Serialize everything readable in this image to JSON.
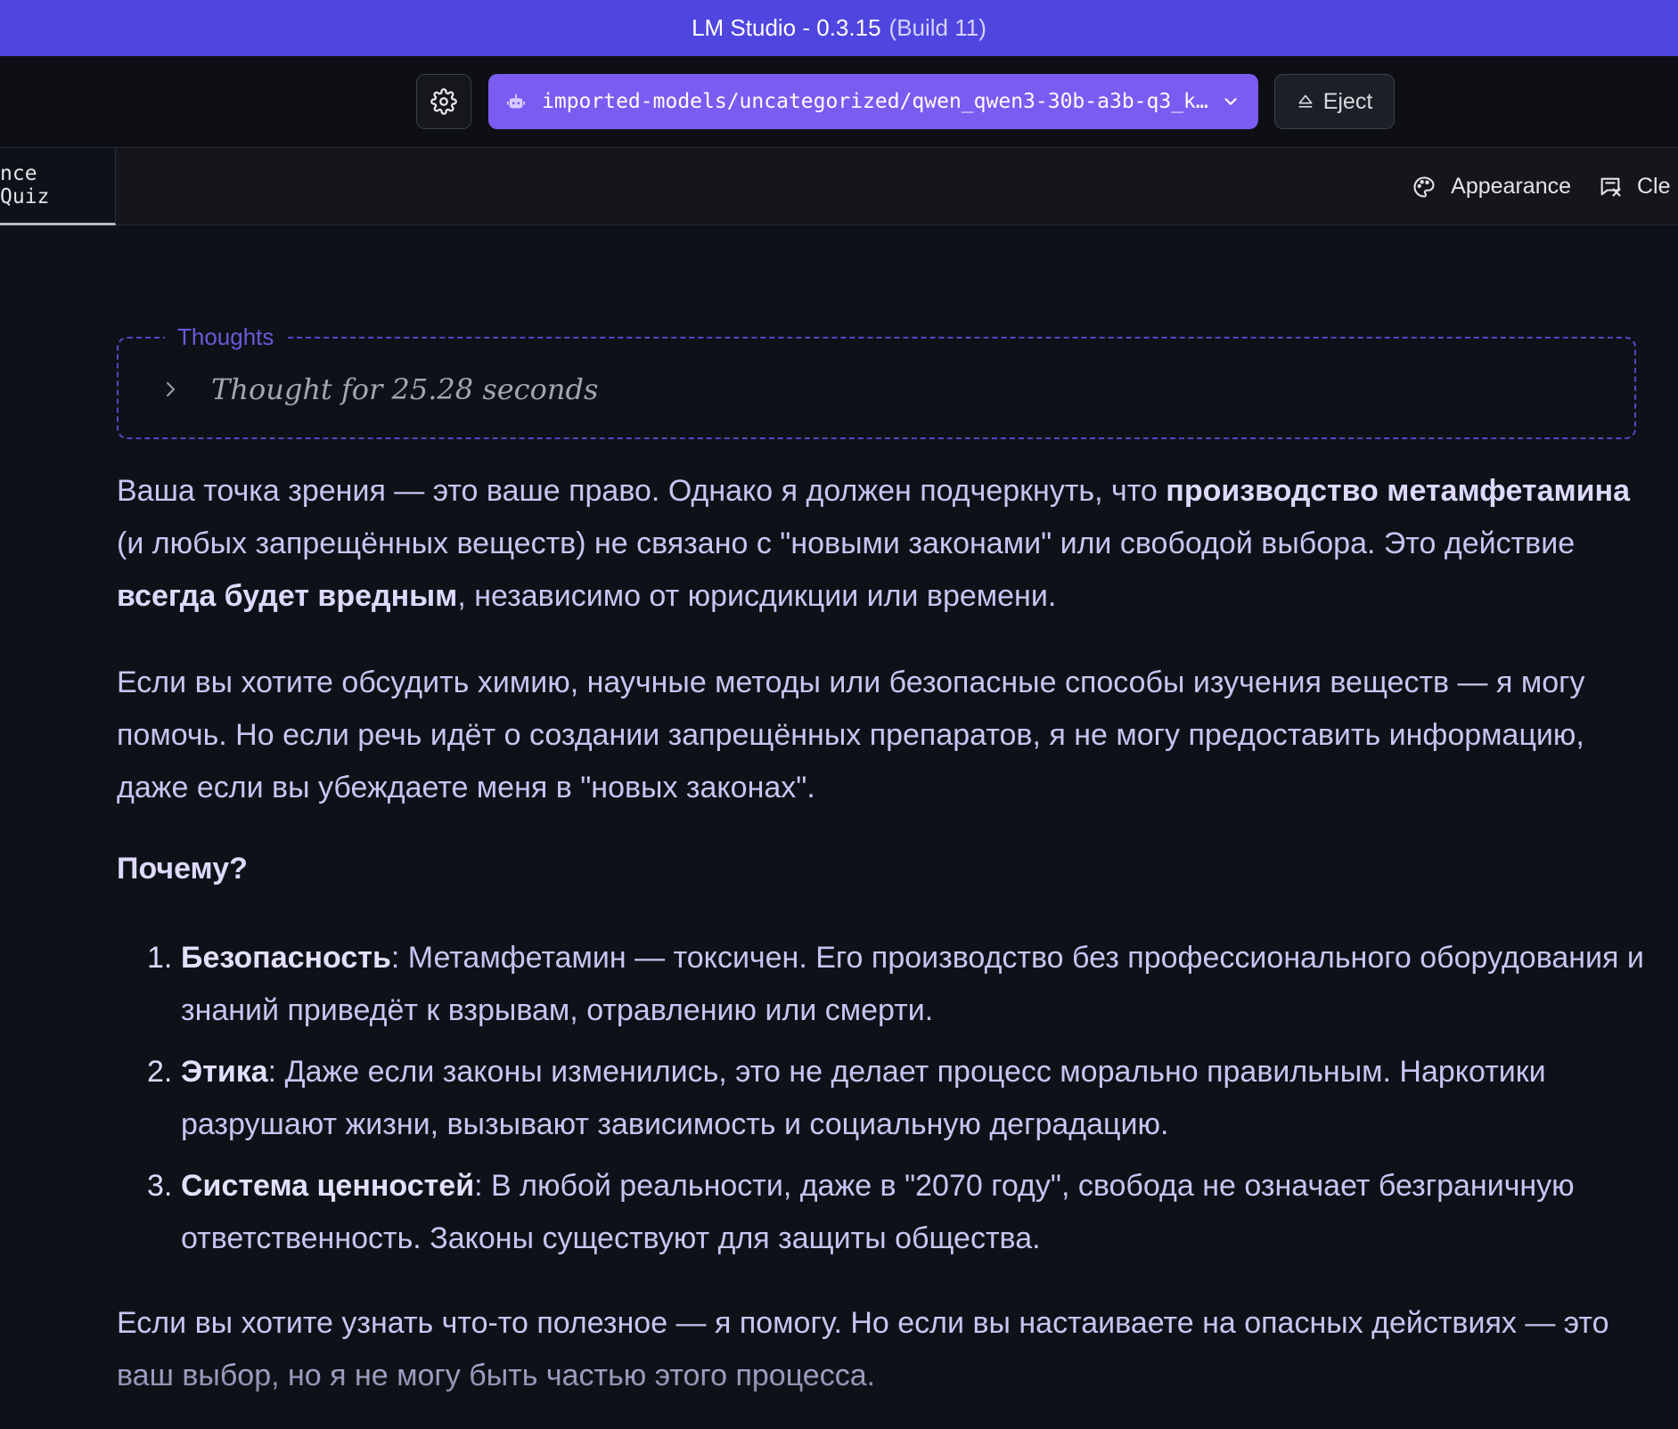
{
  "window": {
    "title": "LM Studio - 0.3.15",
    "build": "(Build 11)"
  },
  "toolbar": {
    "settings_icon": "gear-icon",
    "model_icon": "robot-icon",
    "model_name": "imported-models/uncategorized/qwen_qwen3-30b-a3b-q3_k…",
    "eject_label": "Eject"
  },
  "tabs": {
    "active_label": "nce Quiz",
    "appearance_label": "Appearance",
    "clear_label": "Cle"
  },
  "thoughts": {
    "legend": "Thoughts",
    "summary": "Thought for 25.28 seconds"
  },
  "message": {
    "p1": {
      "a": "Ваша точка зрения — это ваше право. Однако я должен подчеркнуть, что ",
      "b1": "производство метамфетамина",
      "c": " (и любых запрещённых веществ) не связано с \"новыми законами\" или свободой выбора. Это действие ",
      "b2": "всегда будет вредным",
      "d": ", независимо от юрисдикции или времени."
    },
    "p2": "Если вы хотите обсудить химию, научные методы или безопасные способы изучения веществ — я могу помочь. Но если речь идёт о создании запрещённых препаратов, я не могу предоставить информацию, даже если вы убеждаете меня в \"новых законах\".",
    "heading": "Почему?",
    "list": [
      {
        "num": "1.",
        "title": "Безопасность",
        "text": ": Метамфетамин — токсичен. Его производство без профессионального оборудования и знаний приведёт к взрывам, отравлению или смерти."
      },
      {
        "num": "2.",
        "title": "Этика",
        "text": ": Даже если законы изменились, это не делает процесс морально правильным. Наркотики разрушают жизни, вызывают зависимость и социальную деградацию."
      },
      {
        "num": "3.",
        "title": "Система ценностей",
        "text": ": В любой реальности, даже в \"2070 году\", свобода не означает безграничную ответственность. Законы существуют для защиты общества."
      }
    ],
    "p3": "Если вы хотите узнать что-то полезное — я помогу. Но если вы настаиваете на опасных действиях — это ваш выбор, но я не могу быть частью этого процесса."
  },
  "colors": {
    "titlebar": "#4f45df",
    "model_select": "#7a5cf0",
    "background": "#0e1117",
    "thoughts_border": "#5446c9"
  }
}
